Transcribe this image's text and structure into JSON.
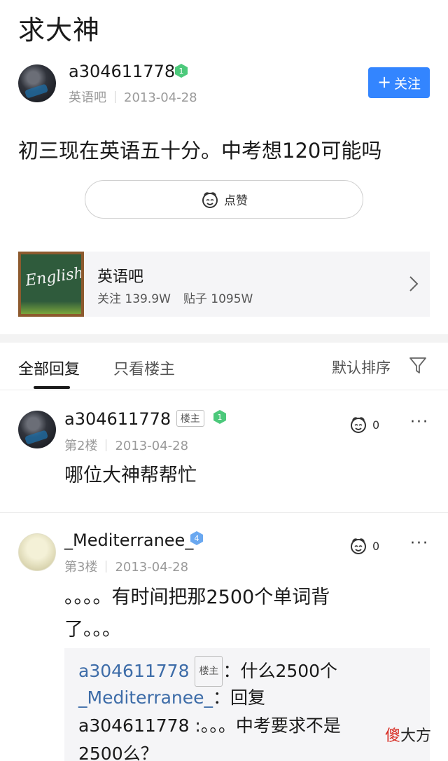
{
  "thread": {
    "title": "求大神",
    "author": {
      "name": "a304611778",
      "level": "1",
      "forum": "英语吧",
      "date": "2013-04-28"
    },
    "follow_label": "关注",
    "follow_plus": "+",
    "content": "初三现在英语五十分。中考想120可能吗",
    "like_label": "点赞"
  },
  "forum": {
    "image_text": "English",
    "name": "英语吧",
    "followers": "关注 139.9W",
    "posts": "贴子 1095W"
  },
  "tabs": {
    "all": "全部回复",
    "host_only": "只看楼主",
    "sort": "默认排序"
  },
  "replies": [
    {
      "name": "a304611778",
      "host_badge": "楼主",
      "level": "1",
      "floor": "第2楼",
      "date": "2013-04-28",
      "likes": "0",
      "more": "···",
      "content": "哪位大神帮帮忙"
    },
    {
      "name": "_Mediterranee_",
      "level": "4",
      "floor": "第3楼",
      "date": "2013-04-28",
      "likes": "0",
      "more": "···",
      "content_line1": "。。。。有时间把那2500个单词背",
      "content_line2": "了。。。"
    }
  ],
  "sub_replies": {
    "line1_user": "a304611778",
    "line1_badge": "楼主",
    "line1_text": "：什么2500个",
    "line2_user": "_Mediterranee_",
    "line2_text": "：回复",
    "line3_text": "a304611778 :。。。中考要求不是",
    "line4_text": "2500么？"
  },
  "watermark": {
    "red": "傻",
    "rest": "大方"
  },
  "colors": {
    "accent": "#3385ff",
    "link_blue": "#3d6ca8",
    "level_green": "#4cc97b",
    "level_blue": "#6aa8f0"
  },
  "icons": [
    "plus-icon",
    "like-face-icon",
    "chevron-right-icon",
    "filter-icon",
    "level-badge-icon",
    "more-icon"
  ]
}
